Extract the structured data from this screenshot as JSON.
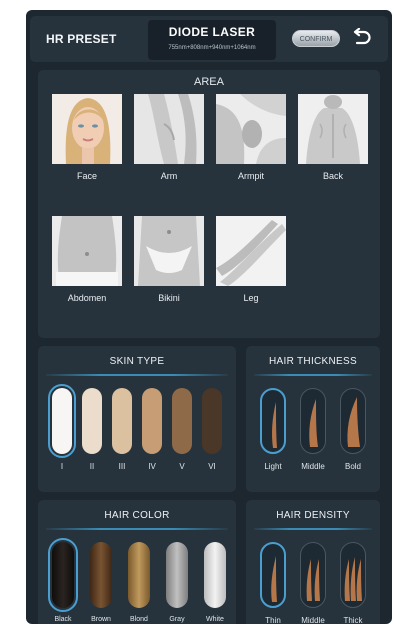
{
  "header": {
    "left_title": "HR PRESET",
    "title": "DIODE LASER",
    "subtitle": "755nm+808nm+940nm+1064nm",
    "confirm_label": "CONFIRM",
    "back_icon": "undo-arrow-icon"
  },
  "area": {
    "title": "AREA",
    "items": [
      {
        "label": "Face"
      },
      {
        "label": "Arm"
      },
      {
        "label": "Armpit"
      },
      {
        "label": "Back"
      },
      {
        "label": "Abdomen"
      },
      {
        "label": "Bikini"
      },
      {
        "label": "Leg"
      }
    ]
  },
  "skin_type": {
    "title": "SKIN TYPE",
    "selected": "I",
    "items": [
      {
        "label": "I",
        "color": "#f7f6f4"
      },
      {
        "label": "II",
        "color": "#ecdccb"
      },
      {
        "label": "III",
        "color": "#dcc1a1"
      },
      {
        "label": "IV",
        "color": "#c69d74"
      },
      {
        "label": "V",
        "color": "#8f6a49"
      },
      {
        "label": "VI",
        "color": "#4a3728"
      }
    ]
  },
  "hair_thickness": {
    "title": "HAIR THICKNESS",
    "selected": "Light",
    "items": [
      {
        "label": "Light"
      },
      {
        "label": "Middle"
      },
      {
        "label": "Bold"
      }
    ]
  },
  "hair_color": {
    "title": "HAIR COLOR",
    "selected": "Black",
    "items": [
      {
        "label": "Black",
        "color": "#1a1614"
      },
      {
        "label": "Brown",
        "color": "#5c3d24"
      },
      {
        "label": "Blond",
        "color": "#9d7a45"
      },
      {
        "label": "Gray",
        "color": "#9c9c9c"
      },
      {
        "label": "White",
        "color": "#d9d9d9"
      }
    ]
  },
  "hair_density": {
    "title": "HAIR DENSITY",
    "selected": "Thin",
    "items": [
      {
        "label": "Thin"
      },
      {
        "label": "Middle"
      },
      {
        "label": "Thick"
      }
    ]
  },
  "colors": {
    "accent": "#4a9fd0",
    "panel": "#26323c",
    "background": "#1d2730",
    "hair": "#b5764a"
  }
}
